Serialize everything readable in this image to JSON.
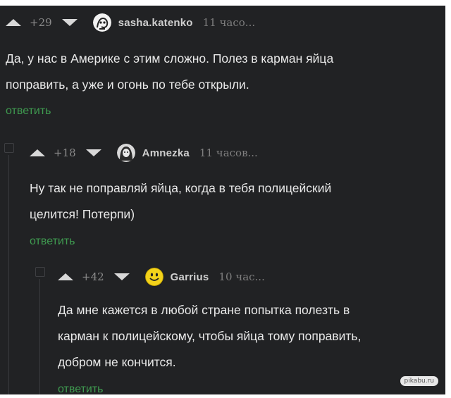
{
  "comments": [
    {
      "rating": "+29",
      "username": "sasha.katenko",
      "time": "11 часо...",
      "lines": [
        "Да, у нас в Америке с этим сложно. Полез в карман яйца",
        "поправить, а уже и огонь по тебе открыли."
      ],
      "reply_label": "ответить",
      "avatar_icon": "avatar-sketch-icon"
    },
    {
      "rating": "+18",
      "username": "Amnezka",
      "time": "11 часов...",
      "lines": [
        "Ну так не поправляй яйца, когда в тебя полицейский",
        "целится! Потерпи)"
      ],
      "reply_label": "ответить",
      "avatar_icon": "avatar-portrait-icon"
    },
    {
      "rating": "+42",
      "username": "Garrius",
      "time": "10 час...",
      "lines": [
        "Да мне кажется в любой стране попытка полезть в",
        "карман к полицейскому, чтобы яйца тому поправить,",
        "добром не кончится."
      ],
      "reply_label": "ответить",
      "avatar_icon": "smiley-face-icon"
    }
  ],
  "watermark": "pikabu.ru",
  "colors": {
    "background": "#212224",
    "reply_link": "#3f9b50",
    "text": "#e9e9e9"
  }
}
